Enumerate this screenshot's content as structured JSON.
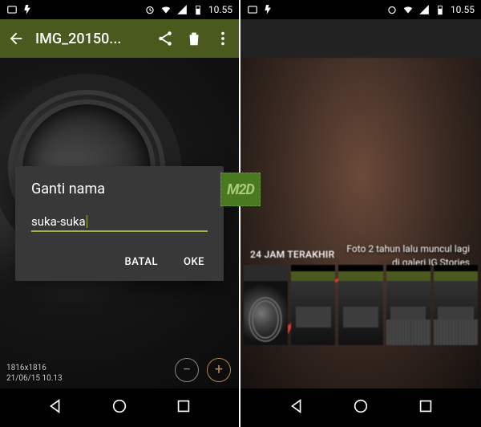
{
  "status": {
    "time": "10.55"
  },
  "left": {
    "appbar": {
      "title": "IMG_20150..."
    },
    "dialog": {
      "title": "Ganti nama",
      "value": "suka-suka",
      "cancel": "BATAL",
      "ok": "OKE"
    },
    "meta": {
      "dims": "1816x1816",
      "date": "21/06/15 10.13"
    }
  },
  "right": {
    "annotation_l1": "Foto 2 tahun lalu muncul lagi",
    "annotation_l2": "di galeri IG Stories",
    "strip_label": "24 JAM TERAKHIR"
  },
  "watermark": "M2D"
}
